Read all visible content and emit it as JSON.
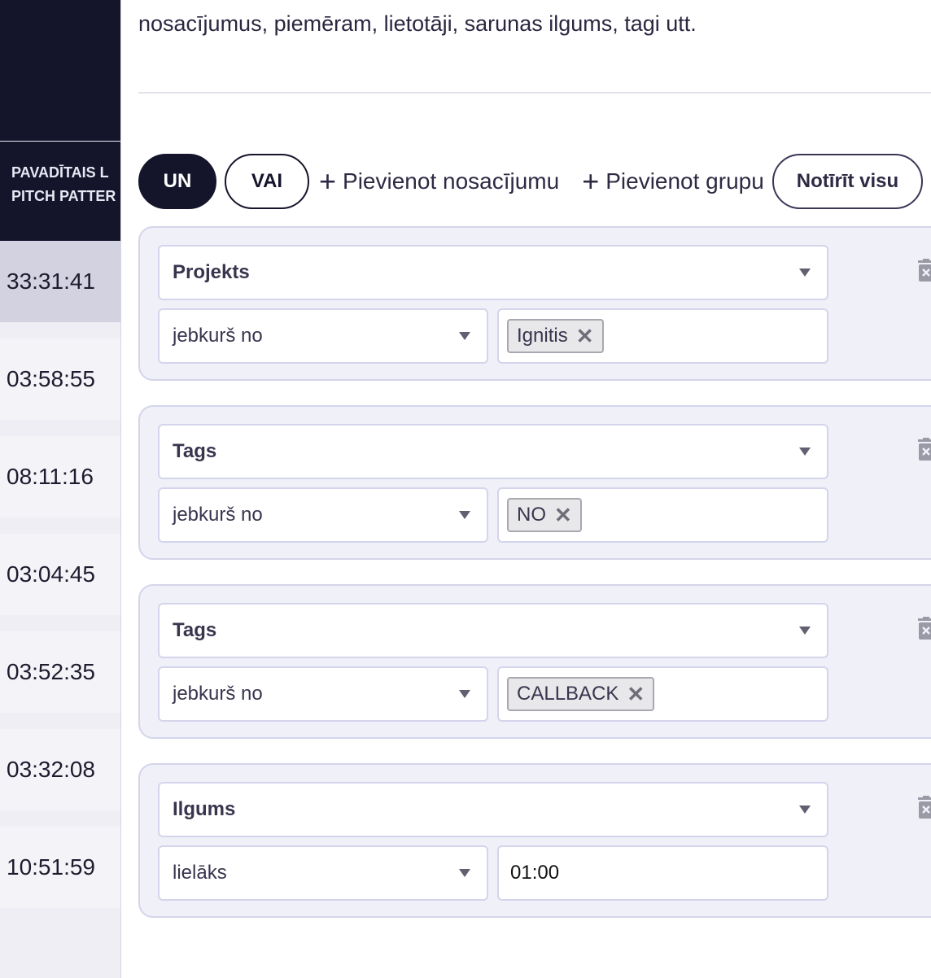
{
  "background_table": {
    "header_line1": "PAVADĪTAIS L",
    "header_line2": "PITCH PATTER",
    "times": [
      "33:31:41",
      "03:58:55",
      "08:11:16",
      "03:04:45",
      "03:52:35",
      "03:32:08",
      "10:51:59"
    ]
  },
  "panel": {
    "description": "nosacījumus, piemēram, lietotāji, sarunas ilgums, tagi utt.",
    "toolbar": {
      "and_label": "UN",
      "or_label": "VAI",
      "add_condition_label": "Pievienot nosacījumu",
      "add_group_label": "Pievienot grupu",
      "clear_label": "Notīrīt visu"
    },
    "conditions": [
      {
        "field": "Projekts",
        "operator": "jebkurš no",
        "tag": "Ignitis"
      },
      {
        "field": "Tags",
        "operator": "jebkurš no",
        "tag": "NO"
      },
      {
        "field": "Tags",
        "operator": "jebkurš no",
        "tag": "CALLBACK"
      },
      {
        "field": "Ilgums",
        "operator": "lielāks",
        "value": "01:00"
      }
    ]
  },
  "icons": {
    "plus": "plus-icon",
    "arrow": "chevron-down-icon",
    "remove": "close-icon",
    "delete": "trash-icon"
  },
  "colors": {
    "primary_dark": "#14142b",
    "group_bg": "#f0f0f8",
    "border": "#d4d4ec"
  }
}
